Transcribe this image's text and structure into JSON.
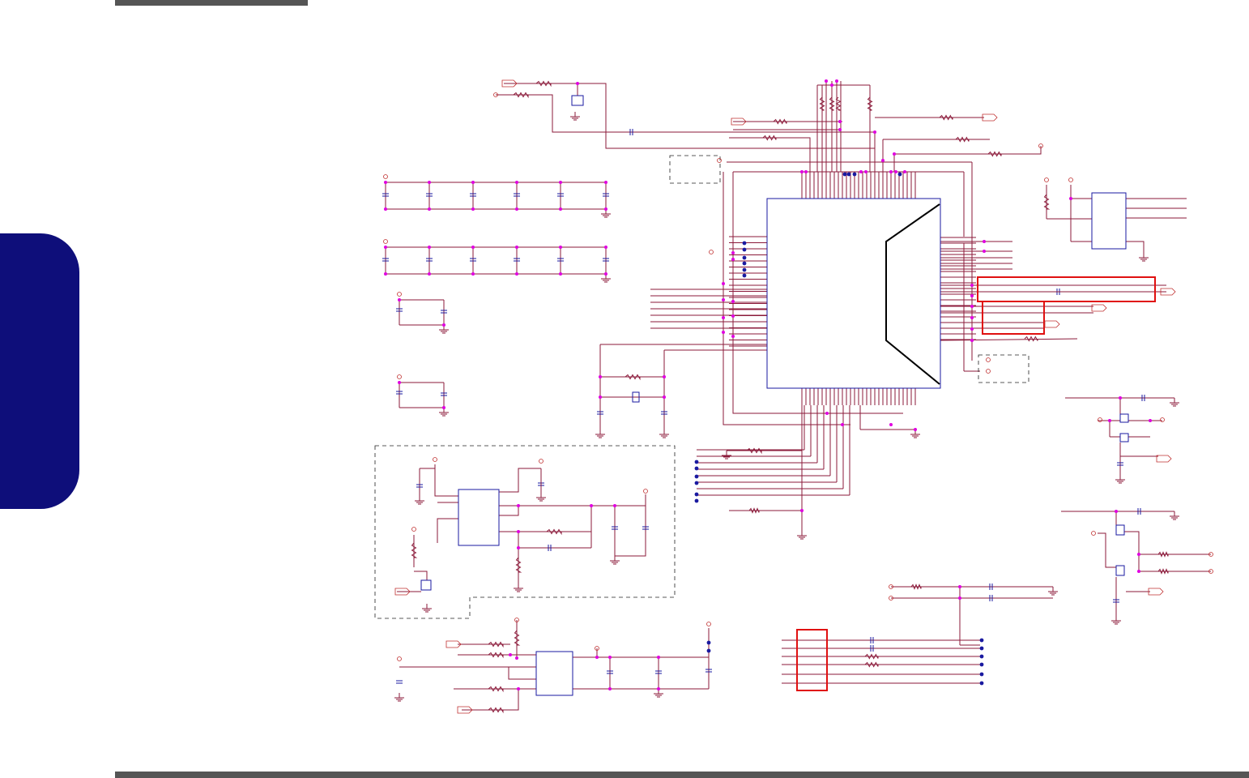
{
  "page": {
    "header_bar_color": "#555555",
    "footer_bar_color": "#555555",
    "side_tab_color": "#0e0e7a"
  },
  "schematic": {
    "wire_color": "#8b1a3a",
    "junction_color": "#e000e0",
    "component_color": "#1a1aa0",
    "highlight_color": "#e01010",
    "power_port_color": "#c03030",
    "text": []
  }
}
